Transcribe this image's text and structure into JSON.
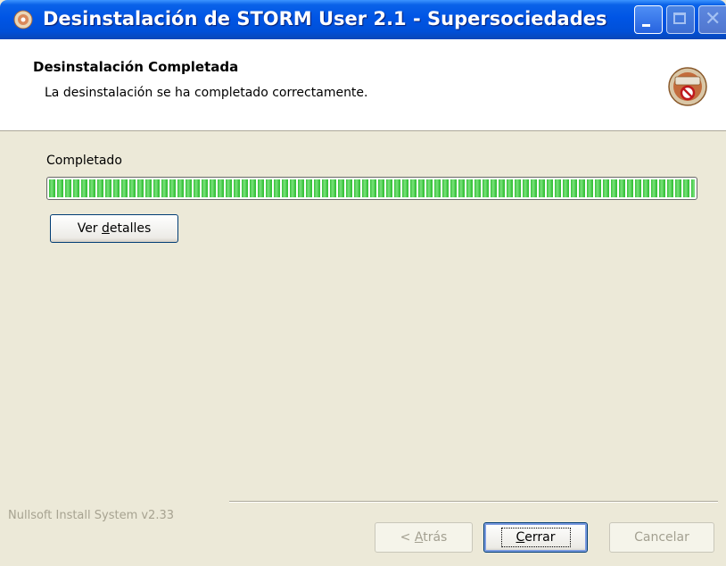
{
  "window": {
    "title": "Desinstalación de STORM User 2.1 - Supersociedades"
  },
  "header": {
    "title": "Desinstalación Completada",
    "subtitle": "La desinstalación se ha completado correctamente."
  },
  "status": {
    "label": "Completado",
    "progress_percent": 100
  },
  "buttons": {
    "details": {
      "prefix": "Ver ",
      "mnemonic": "d",
      "suffix": "etalles"
    },
    "back": {
      "prefix": "< ",
      "mnemonic": "A",
      "suffix": "trás"
    },
    "close": {
      "prefix": "",
      "mnemonic": "C",
      "suffix": "errar"
    },
    "cancel": {
      "label": "Cancelar"
    }
  },
  "branding": {
    "text": "Nullsoft Install System v2.33"
  },
  "icons": {
    "title": "storm-installer-icon",
    "header": "uninstall-disc-icon"
  },
  "colors": {
    "progress": "#37c23a",
    "titlebar": "#0055e5"
  }
}
